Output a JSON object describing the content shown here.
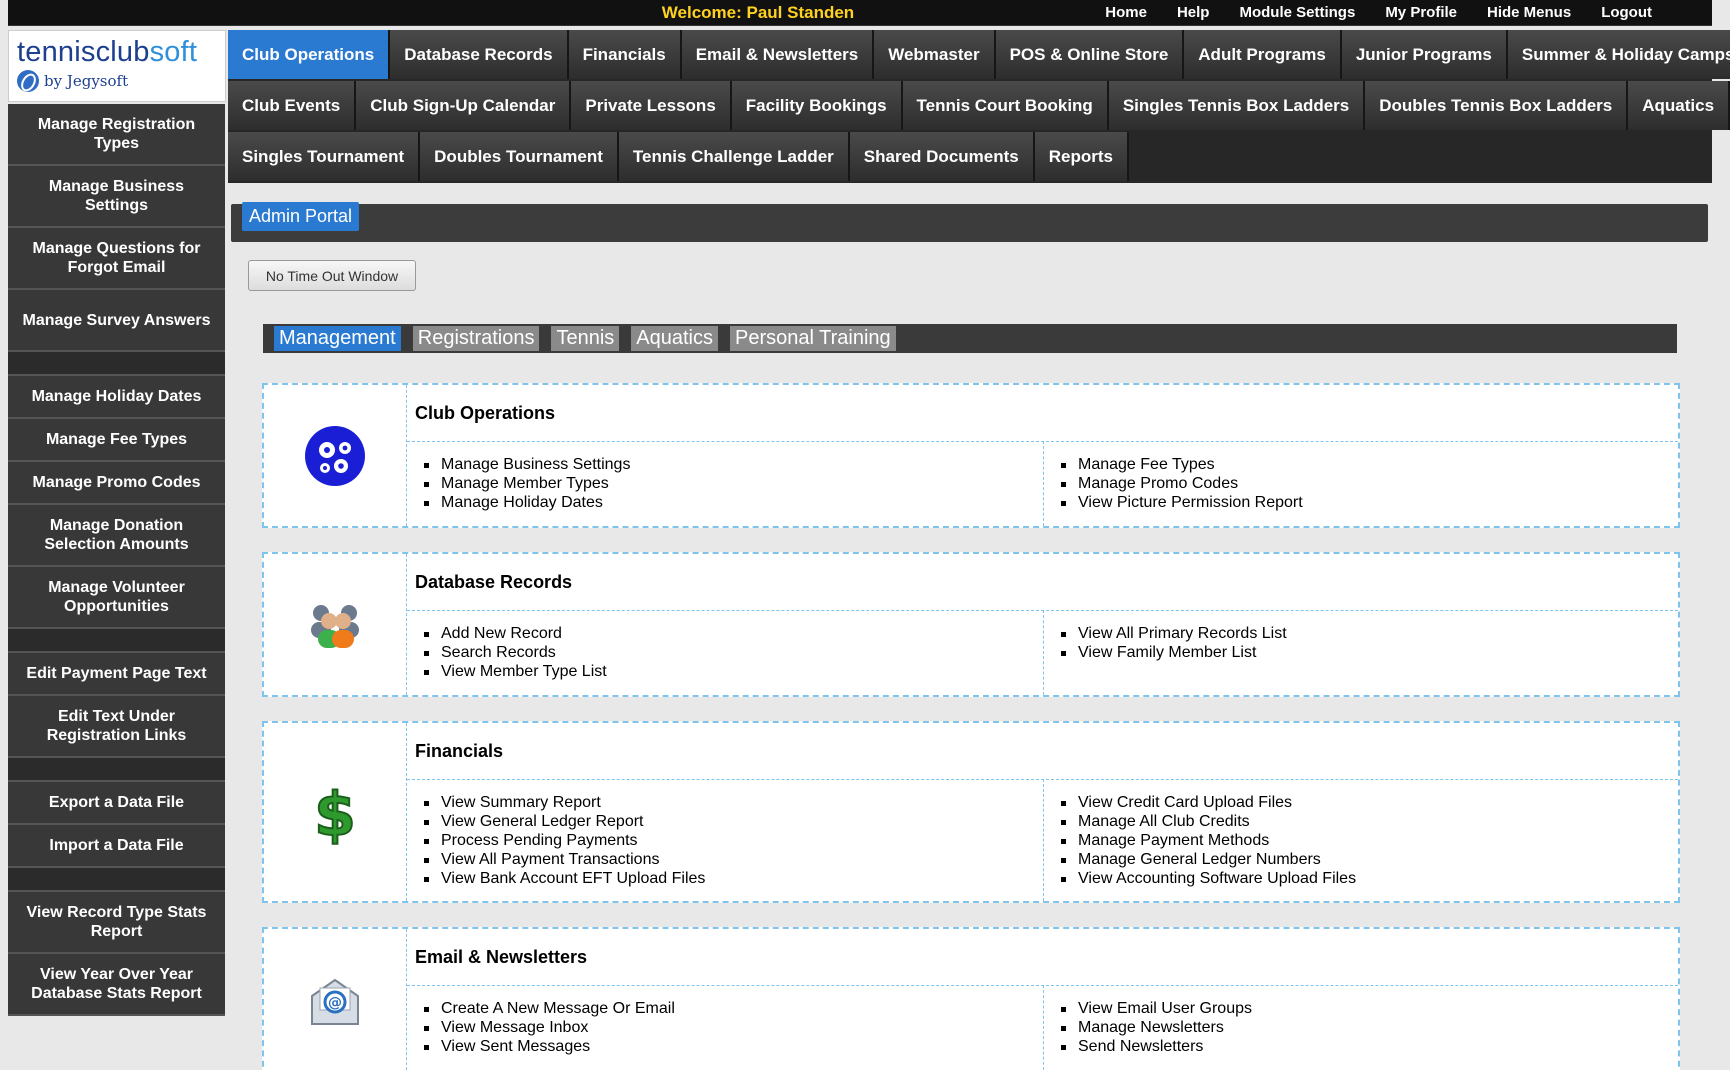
{
  "topbar": {
    "welcome": "Welcome: Paul Standen",
    "links": [
      "Home",
      "Help",
      "Module Settings",
      "My Profile",
      "Hide Menus",
      "Logout"
    ]
  },
  "logo": {
    "brand_a": "tennisclub",
    "brand_b": "soft",
    "by": "by Jegysoft"
  },
  "nav": {
    "rows": [
      [
        "Club Operations",
        "Database Records",
        "Financials",
        "Email & Newsletters",
        "Webmaster",
        "POS & Online Store",
        "Adult Programs",
        "Junior Programs",
        "Summer & Holiday Camps"
      ],
      [
        "Club Events",
        "Club Sign-Up Calendar",
        "Private Lessons",
        "Facility Bookings",
        "Tennis Court Booking",
        "Singles Tennis Box Ladders",
        "Doubles Tennis Box Ladders",
        "Aquatics"
      ],
      [
        "Singles Tournament",
        "Doubles Tournament",
        "Tennis Challenge Ladder",
        "Shared Documents",
        "Reports"
      ]
    ],
    "active": "Club Operations"
  },
  "sidebar": {
    "items": [
      "Manage Registration Types",
      "Manage Business Settings",
      "Manage Questions for Forgot Email",
      "Manage Survey Answers",
      "",
      "Manage Holiday Dates",
      "Manage Fee Types",
      "Manage Promo Codes",
      "Manage Donation Selection Amounts",
      "Manage Volunteer Opportunities",
      "",
      "Edit Payment Page Text",
      "Edit Text Under Registration Links",
      "",
      "Export a Data File",
      "Import a Data File",
      "",
      "View Record Type Stats Report",
      "View Year Over Year Database Stats Report"
    ]
  },
  "portal": {
    "tab": "Admin Portal",
    "no_timeout": "No Time Out Window"
  },
  "section_tabs": [
    "Management",
    "Registrations",
    "Tennis",
    "Aquatics",
    "Personal Training"
  ],
  "section_active": "Management",
  "panels": [
    {
      "title": "Club Operations",
      "icon": "gears-icon",
      "left": [
        "Manage Business Settings",
        "Manage Member Types",
        "Manage Holiday Dates"
      ],
      "right": [
        "Manage Fee Types",
        "Manage Promo Codes",
        "View Picture Permission Report"
      ]
    },
    {
      "title": "Database Records",
      "icon": "people-icon",
      "left": [
        "Add New Record",
        "Search Records",
        "View Member Type List"
      ],
      "right": [
        "View All Primary Records List",
        "View Family Member List"
      ]
    },
    {
      "title": "Financials",
      "icon": "dollar-icon",
      "left": [
        "View Summary Report",
        "View General Ledger Report",
        "Process Pending Payments",
        "View All Payment Transactions",
        "View Bank Account EFT Upload Files"
      ],
      "right": [
        "View Credit Card Upload Files",
        "Manage All Club Credits",
        "Manage Payment Methods",
        "Manage General Ledger Numbers",
        "View Accounting Software Upload Files"
      ]
    },
    {
      "title": "Email & Newsletters",
      "icon": "email-icon",
      "left": [
        "Create A New Message Or Email",
        "View Message Inbox",
        "View Sent Messages"
      ],
      "right": [
        "View Email User Groups",
        "Manage Newsletters",
        "Send Newsletters"
      ]
    }
  ],
  "colors": {
    "accent": "#2b7ad1",
    "welcome": "#ffd21f",
    "panel_border": "#7fc4ec"
  }
}
